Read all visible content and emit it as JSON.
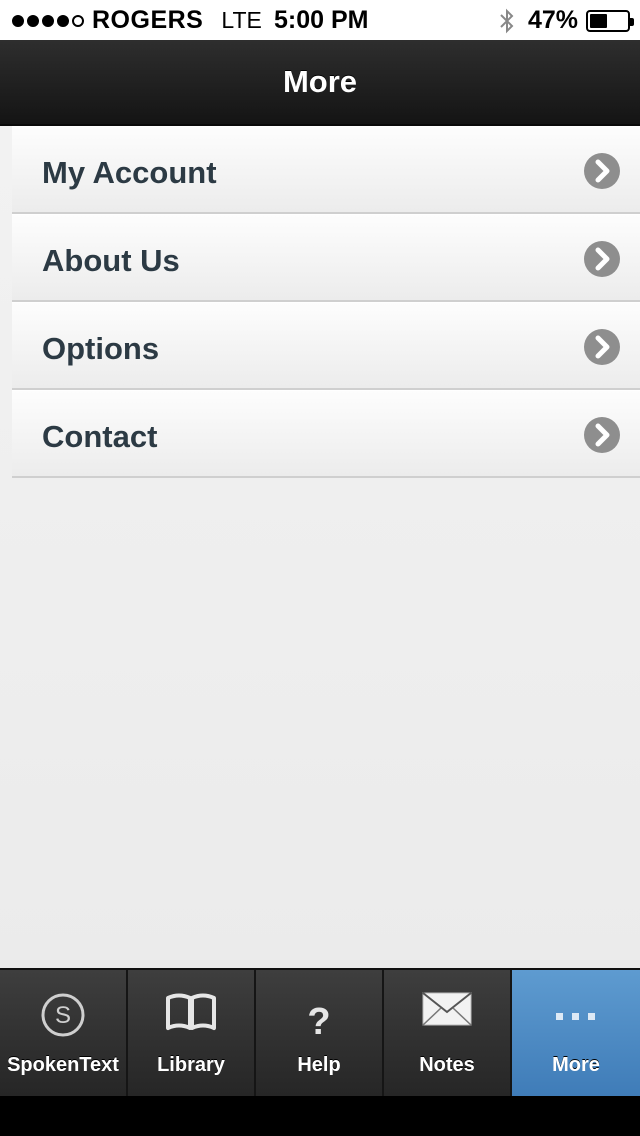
{
  "status_bar": {
    "carrier": "ROGERS",
    "network": "LTE",
    "time": "5:00 PM",
    "battery_percent": "47%",
    "battery_level": 0.47,
    "signal_bars_filled": 4,
    "signal_bars_total": 5
  },
  "nav": {
    "title": "More"
  },
  "menu": {
    "items": [
      {
        "label": "My Account"
      },
      {
        "label": "About Us"
      },
      {
        "label": "Options"
      },
      {
        "label": "Contact"
      }
    ]
  },
  "tab_bar": {
    "tabs": [
      {
        "label": "SpokenText",
        "icon": "spokentext-s-icon",
        "active": false
      },
      {
        "label": "Library",
        "icon": "book-icon",
        "active": false
      },
      {
        "label": "Help",
        "icon": "question-mark-icon",
        "active": false
      },
      {
        "label": "Notes",
        "icon": "envelope-icon",
        "active": false
      },
      {
        "label": "More",
        "icon": "ellipsis-icon",
        "active": true
      }
    ]
  },
  "colors": {
    "nav_background": "#1c1c1c",
    "menu_text": "#2c3a44",
    "chevron_circle": "#8e8e8e",
    "active_tab": "#4f8cc4"
  }
}
